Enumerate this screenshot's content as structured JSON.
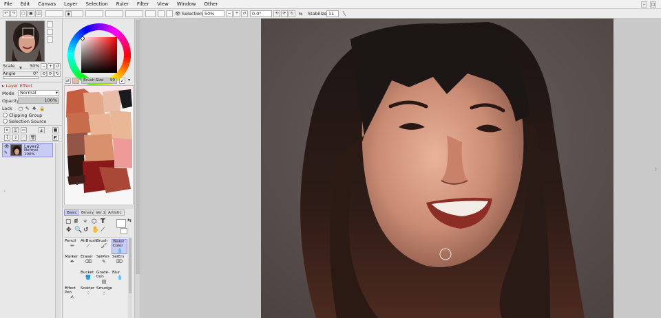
{
  "menu": {
    "items": [
      "File",
      "Edit",
      "Canvas",
      "Layer",
      "Selection",
      "Ruler",
      "Filter",
      "View",
      "Window",
      "Other"
    ]
  },
  "toolbar": {
    "selection_label": "Selection",
    "zoom_value": "50%",
    "angle_value": "0.0°",
    "stabilizer_label": "Stabilizer",
    "stabilizer_value": "11"
  },
  "navigator": {
    "scale_label": "Scale",
    "scale_value": "50%",
    "angle_label": "Angle",
    "angle_value": "0°",
    "scale_fraction": 0.5
  },
  "layer_effect": {
    "header": "Layer Effect",
    "mode_label": "Mode",
    "mode_value": "Normal",
    "opacity_label": "Opacity",
    "opacity_value": "100%",
    "lock_label": "Lock",
    "clipping_group_label": "Clipping Group",
    "selection_source_label": "Selection Source"
  },
  "layers": [
    {
      "name": "Layer2",
      "mode": "Normal",
      "opacity": "100%"
    }
  ],
  "brush": {
    "size_label": "Brush Size",
    "size_value": "50"
  },
  "tool_tabs": [
    "Basic",
    "Binary",
    "Ver.1",
    "Artistic"
  ],
  "tools": [
    {
      "label": "Pencil",
      "icon": "pencil-icon"
    },
    {
      "label": "AirBrush",
      "icon": "airbrush-icon"
    },
    {
      "label": "Brush",
      "icon": "brush-icon"
    },
    {
      "label": "Water Color",
      "icon": "watercolor-icon"
    },
    {
      "label": "Marker",
      "icon": "marker-icon"
    },
    {
      "label": "Eraser",
      "icon": "eraser-icon"
    },
    {
      "label": "SelPen",
      "icon": "selpen-icon"
    },
    {
      "label": "SelErs",
      "icon": "selers-icon"
    },
    {
      "label": "",
      "icon": "empty"
    },
    {
      "label": "Bucket",
      "icon": "bucket-icon"
    },
    {
      "label": "Grade- tion",
      "icon": "gradation-icon"
    },
    {
      "label": "Blur",
      "icon": "blur-icon"
    },
    {
      "label": "Effect Pen",
      "icon": "effect-pen-icon"
    },
    {
      "label": "Scatter",
      "icon": "scatter-icon"
    },
    {
      "label": "Smudge",
      "icon": "smudge-icon"
    },
    {
      "label": "",
      "icon": "empty"
    }
  ],
  "colors": {
    "app_bg": "#d8d8d8",
    "canvas_bg": "#c9c9c9",
    "layer_selected": "#c8cbf2",
    "selected_color": "#8a1a1a"
  }
}
